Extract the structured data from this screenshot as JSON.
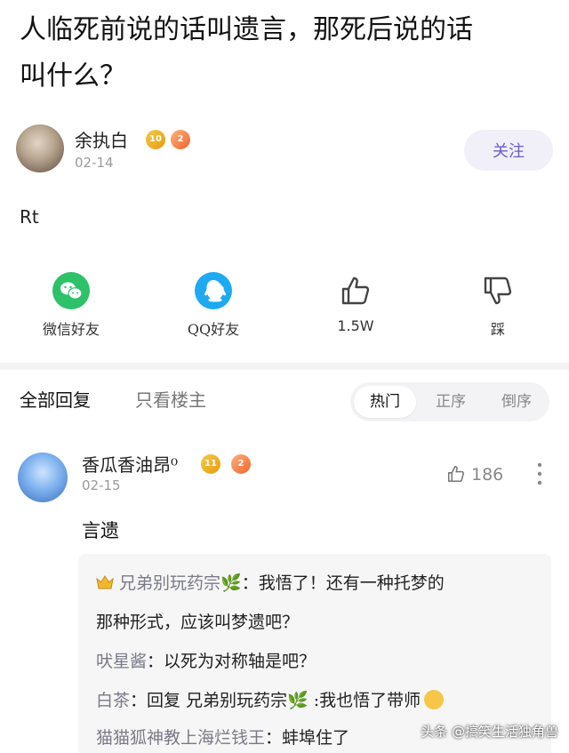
{
  "post": {
    "title_line1": "人临死前说的话叫遗言，那死后说的话",
    "title_line2": "叫什么？",
    "body": "Rt"
  },
  "author": {
    "name": "余执白",
    "level_badge": "10",
    "fire_badge": "2",
    "date": "02-14",
    "follow_label": "关注"
  },
  "share": {
    "wechat_label": "微信好友",
    "qq_label": "QQ好友",
    "like_label": "1.5W",
    "dislike_label": "踩"
  },
  "replies_nav": {
    "all_label": "全部回复",
    "owner_only_label": "只看楼主",
    "sort_hot": "热门",
    "sort_asc": "正序",
    "sort_desc": "倒序"
  },
  "comment": {
    "name": "香瓜香油昂⁰",
    "level_badge": "11",
    "fire_badge": "2",
    "date": "02-15",
    "likes": "186",
    "text": "言遗",
    "subreplies": [
      {
        "user": "兄弟别玩药宗",
        "text": "：我悟了！还有一种托梦的"
      },
      {
        "user": "",
        "text": "那种形式，应该叫梦遗吧？"
      },
      {
        "user": "吠星酱",
        "text": "：以死为对称轴是吧？"
      },
      {
        "user": "白茶",
        "text": "：回复 兄弟别玩药宗🌿 :我也悟了带师"
      },
      {
        "user": "猫猫狐神教上海烂钱王",
        "text": "：蚌埠住了"
      }
    ]
  },
  "watermark": "头条 @搞笑生活独角兽",
  "colors": {
    "accent": "#6c5cc8",
    "wechat": "#2dc16a",
    "qq": "#1eaaf1"
  }
}
